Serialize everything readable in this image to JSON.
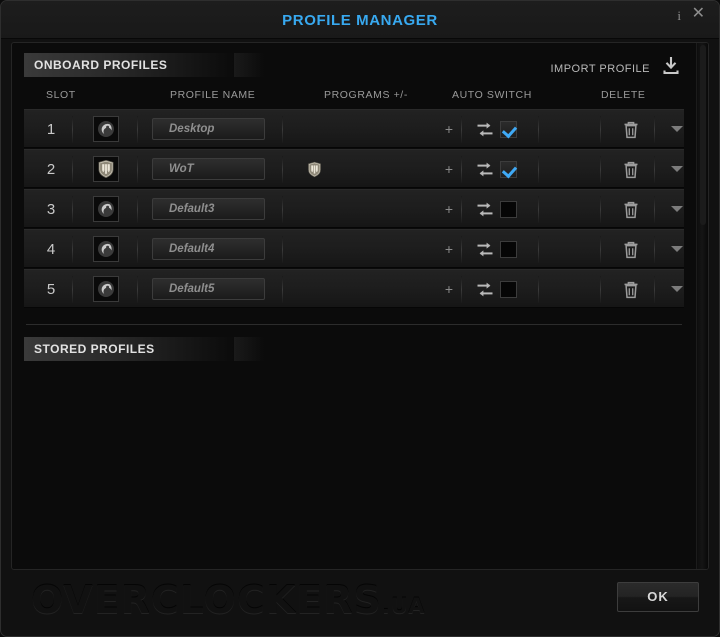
{
  "window": {
    "title": "PROFILE MANAGER",
    "title_color": "#38a9f0",
    "info_icon": "i",
    "close_icon": "✕"
  },
  "onboard_section": {
    "heading": "ONBOARD PROFILES",
    "import_label": "IMPORT PROFILE",
    "import_icon": "download-icon"
  },
  "columns": {
    "slot": "SLOT",
    "profile_name": "PROFILE NAME",
    "programs": "PROGRAMS +/-",
    "auto_switch": "AUTO SWITCH",
    "delete": "DELETE"
  },
  "rows": [
    {
      "slot": "1",
      "profile_icon": "roccat-logo-icon",
      "name": "Desktop",
      "name_placeholder": "Desktop",
      "program_icon": "",
      "add_label": "+",
      "auto_switch": true,
      "delete_icon": "trash-icon",
      "expand_icon": "chevron-down-icon"
    },
    {
      "slot": "2",
      "profile_icon": "world-of-tanks-icon",
      "name": "WoT",
      "name_placeholder": "WoT",
      "program_icon": "world-of-tanks-icon",
      "add_label": "+",
      "auto_switch": true,
      "delete_icon": "trash-icon",
      "expand_icon": "chevron-down-icon"
    },
    {
      "slot": "3",
      "profile_icon": "roccat-logo-icon",
      "name": "Default3",
      "name_placeholder": "Default3",
      "program_icon": "",
      "add_label": "+",
      "auto_switch": false,
      "delete_icon": "trash-icon",
      "expand_icon": "chevron-down-icon"
    },
    {
      "slot": "4",
      "profile_icon": "roccat-logo-icon",
      "name": "Default4",
      "name_placeholder": "Default4",
      "program_icon": "",
      "add_label": "+",
      "auto_switch": false,
      "delete_icon": "trash-icon",
      "expand_icon": "chevron-down-icon"
    },
    {
      "slot": "5",
      "profile_icon": "roccat-logo-icon",
      "name": "Default5",
      "name_placeholder": "Default5",
      "program_icon": "",
      "add_label": "+",
      "auto_switch": false,
      "delete_icon": "trash-icon",
      "expand_icon": "chevron-down-icon"
    }
  ],
  "stored_section": {
    "heading": "STORED PROFILES",
    "items": []
  },
  "footer": {
    "watermark_main": "OVERCLOCKERS",
    "watermark_tld": ".UA",
    "ok_label": "OK"
  },
  "accent_color": "#3fa9f5"
}
